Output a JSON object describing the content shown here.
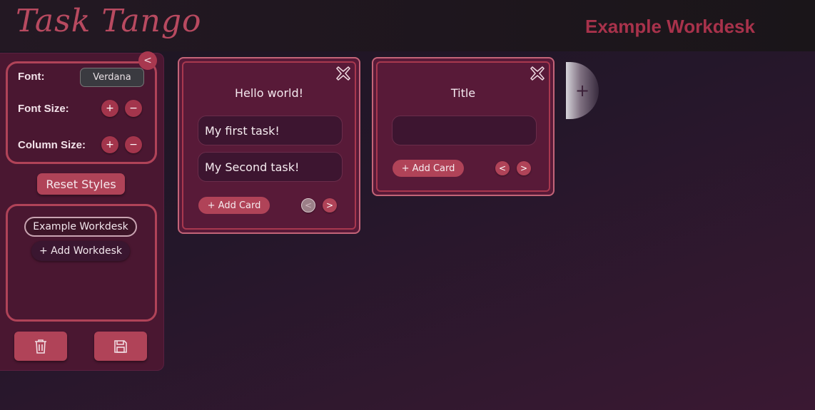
{
  "app": {
    "logo": "Task Tango",
    "workdesk_title": "Example Workdesk"
  },
  "sidebar": {
    "collapse_label": "<",
    "font_label": "Font:",
    "font_value": "Verdana",
    "font_size_label": "Font Size:",
    "column_size_label": "Column Size:",
    "plus": "+",
    "minus": "−",
    "reset_label": "Reset Styles",
    "workdesks": [
      "Example Workdesk"
    ],
    "add_workdesk_label": "+ Add Workdesk",
    "delete_icon": "trash-icon",
    "save_icon": "floppy-icon"
  },
  "columns": [
    {
      "title": "Hello world!",
      "cards": [
        "My first task!",
        "My Second task!"
      ],
      "add_card_label": "+ Add Card",
      "prev": "<",
      "next": ">"
    },
    {
      "title": "Title",
      "cards": [
        ""
      ],
      "add_card_label": "+ Add Card",
      "prev": "<",
      "next": ">"
    }
  ],
  "add_column_label": "+",
  "colors": {
    "accent": "#b04358",
    "brand": "#b84a60",
    "title": "#a8324b"
  }
}
